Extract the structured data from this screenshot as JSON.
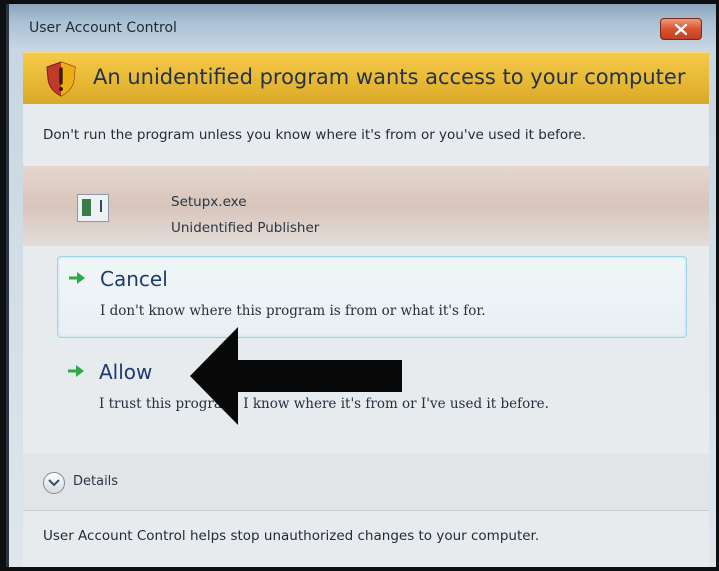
{
  "dialog": {
    "title": "User Account Control",
    "banner_text": "An unidentified program wants access to your computer",
    "warning_text": "Don't run the program unless you know where it's from or you've used it before.",
    "program": {
      "name": "Setupx.exe",
      "publisher": "Unidentified Publisher"
    },
    "options": [
      {
        "title": "Cancel",
        "description": "I don't know where this program is from or what it's for."
      },
      {
        "title": "Allow",
        "description": "I trust this program. I know where it's from or I've used it before."
      }
    ],
    "details_label": "Details",
    "footer_text": "User Account Control helps stop unauthorized changes to your computer."
  },
  "icons": {
    "close": "close-icon",
    "shield": "shield-warning-icon",
    "option_arrow": "green-arrow-icon",
    "details": "chevron-down-icon",
    "annotation": "black-arrow-icon"
  },
  "colors": {
    "banner": "#e8b834",
    "close_button": "#d8542f",
    "option_arrow": "#2fa84a",
    "option_title": "#1e3b6e"
  }
}
